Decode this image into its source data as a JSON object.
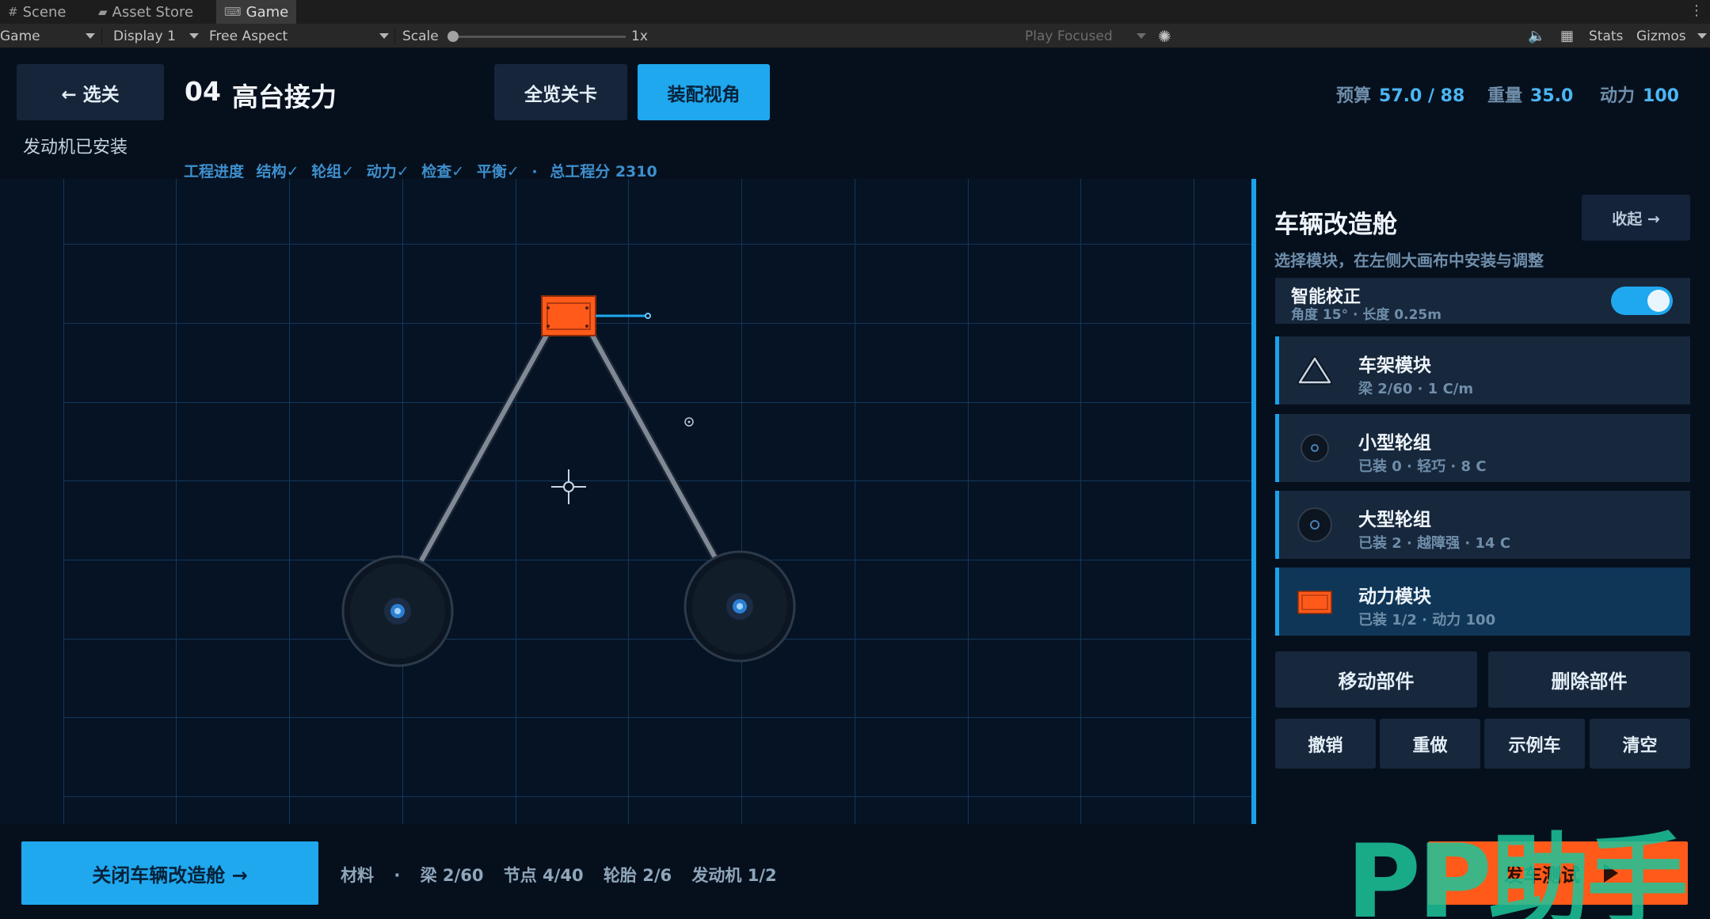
{
  "editor": {
    "tabs": [
      {
        "label": "Scene",
        "icon": "grid-icon"
      },
      {
        "label": "Asset Store",
        "icon": "bag-icon"
      },
      {
        "label": "Game",
        "icon": "gamepad-icon"
      }
    ],
    "toolbar": {
      "mode": "Game",
      "display": "Display 1",
      "aspect": "Free Aspect",
      "scale_label": "Scale",
      "scale_value": "1x",
      "play_mode": "Play Focused",
      "stats": "Stats",
      "gizmos": "Gizmos"
    }
  },
  "header": {
    "back_label": "← 选关",
    "level_number": "04",
    "level_title": "高台接力",
    "overview_label": "全览关卡",
    "assembly_label": "装配视角",
    "engine_status": "发动机已安装",
    "stats": [
      {
        "label": "预算",
        "value": "57.0 / 88"
      },
      {
        "label": "重量",
        "value": "35.0"
      },
      {
        "label": "动力",
        "value": "100"
      }
    ],
    "progress": {
      "label": "工程进度",
      "items": [
        "结构✓",
        "轮组✓",
        "动力✓",
        "检查✓",
        "平衡✓"
      ],
      "separator": "·",
      "total": "总工程分 2310"
    }
  },
  "panel": {
    "title": "车辆改造舱",
    "collapse_label": "收起 →",
    "subtitle": "选择模块，在左侧大画布中安装与调整",
    "smart_title": "智能校正",
    "smart_detail": "角度 15° · 长度 0.25m",
    "smart_on": true,
    "modules": [
      {
        "title": "车架模块",
        "detail": "梁 2/60 · 1 C/m",
        "icon": "triangle-frame-icon",
        "selected": false
      },
      {
        "title": "小型轮组",
        "detail": "已装 0 · 轻巧 · 8 C",
        "icon": "small-wheel-icon",
        "selected": false
      },
      {
        "title": "大型轮组",
        "detail": "已装 2 · 越障强 · 14 C",
        "icon": "large-wheel-icon",
        "selected": false
      },
      {
        "title": "动力模块",
        "detail": "已装 1/2 · 动力 100",
        "icon": "engine-icon",
        "selected": true
      }
    ],
    "actions": {
      "move": "移动部件",
      "delete": "删除部件",
      "undo": "撤销",
      "redo": "重做",
      "sample": "示例车",
      "clear": "清空"
    }
  },
  "footer": {
    "close_label": "关闭车辆改造舱 →",
    "materials": [
      "材料",
      "·",
      "梁 2/60",
      "节点 4/40",
      "轮胎 2/6",
      "发动机 1/2"
    ],
    "launch_label": "发车测试",
    "watermark": "PP助手"
  },
  "colors": {
    "accent": "#1fa8ee",
    "engine": "#ff5a1a",
    "launch": "#ff5a1a",
    "watermark": "#1dc59a"
  }
}
